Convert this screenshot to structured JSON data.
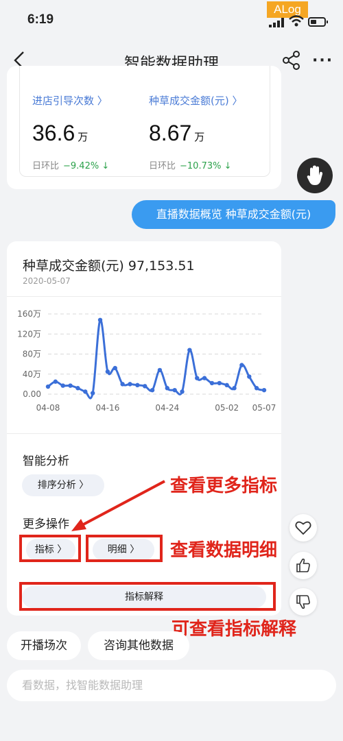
{
  "status": {
    "time": "6:19",
    "alog": "ALog"
  },
  "nav": {
    "title": "智能数据助理"
  },
  "top_card": {
    "metrics": [
      {
        "label": "进店引导次数 〉",
        "value": "36.6",
        "unit": "万",
        "sub_label": "日环比",
        "change": "−9.42% ↓"
      },
      {
        "label": "种草成交金额(元) 〉",
        "value": "8.67",
        "unit": "万",
        "sub_label": "日环比",
        "change": "−10.73% ↓"
      }
    ]
  },
  "user_message": "直播数据概览 种草成交金额(元)",
  "chart_card": {
    "title": "种草成交金额(元) 97,153.51",
    "date": "2020-05-07",
    "smart_analysis_title": "智能分析",
    "sort_analysis_label": "排序分析 〉",
    "more_ops_title": "更多操作",
    "indicator_label": "指标 〉",
    "detail_label": "明细 〉",
    "explain_label": "指标解释"
  },
  "chart_data": {
    "type": "line",
    "ytick_labels": [
      "160万",
      "120万",
      "80万",
      "40万",
      "0.00"
    ],
    "xtick_labels": [
      "04-08",
      "04-16",
      "04-24",
      "05-02",
      "05-07"
    ],
    "ylim": [
      0,
      160
    ],
    "grid": true,
    "line_color": "#3b6fd8",
    "x": [
      "04-08",
      "04-09",
      "04-10",
      "04-11",
      "04-12",
      "04-13",
      "04-14",
      "04-15",
      "04-16",
      "04-17",
      "04-18",
      "04-19",
      "04-20",
      "04-21",
      "04-22",
      "04-23",
      "04-24",
      "04-25",
      "04-26",
      "04-27",
      "04-28",
      "04-29",
      "04-30",
      "05-01",
      "05-02",
      "05-03",
      "05-04",
      "05-05",
      "05-06",
      "05-07"
    ],
    "values": [
      15,
      25,
      17,
      17,
      12,
      5,
      2,
      148,
      45,
      52,
      20,
      20,
      18,
      16,
      8,
      48,
      12,
      8,
      5,
      88,
      32,
      32,
      22,
      22,
      18,
      12,
      58,
      35,
      12,
      8
    ]
  },
  "annotations": {
    "more_indicators": "查看更多指标",
    "view_detail": "查看数据明细",
    "view_explain": "可查看指标解释"
  },
  "suggestions": [
    "开播场次",
    "咨询其他数据"
  ],
  "input_placeholder": "看数据，找智能数据助理",
  "colors": {
    "accent": "#3a9bf0",
    "annotation": "#e0251b",
    "positive_change": "#2ba14a"
  }
}
